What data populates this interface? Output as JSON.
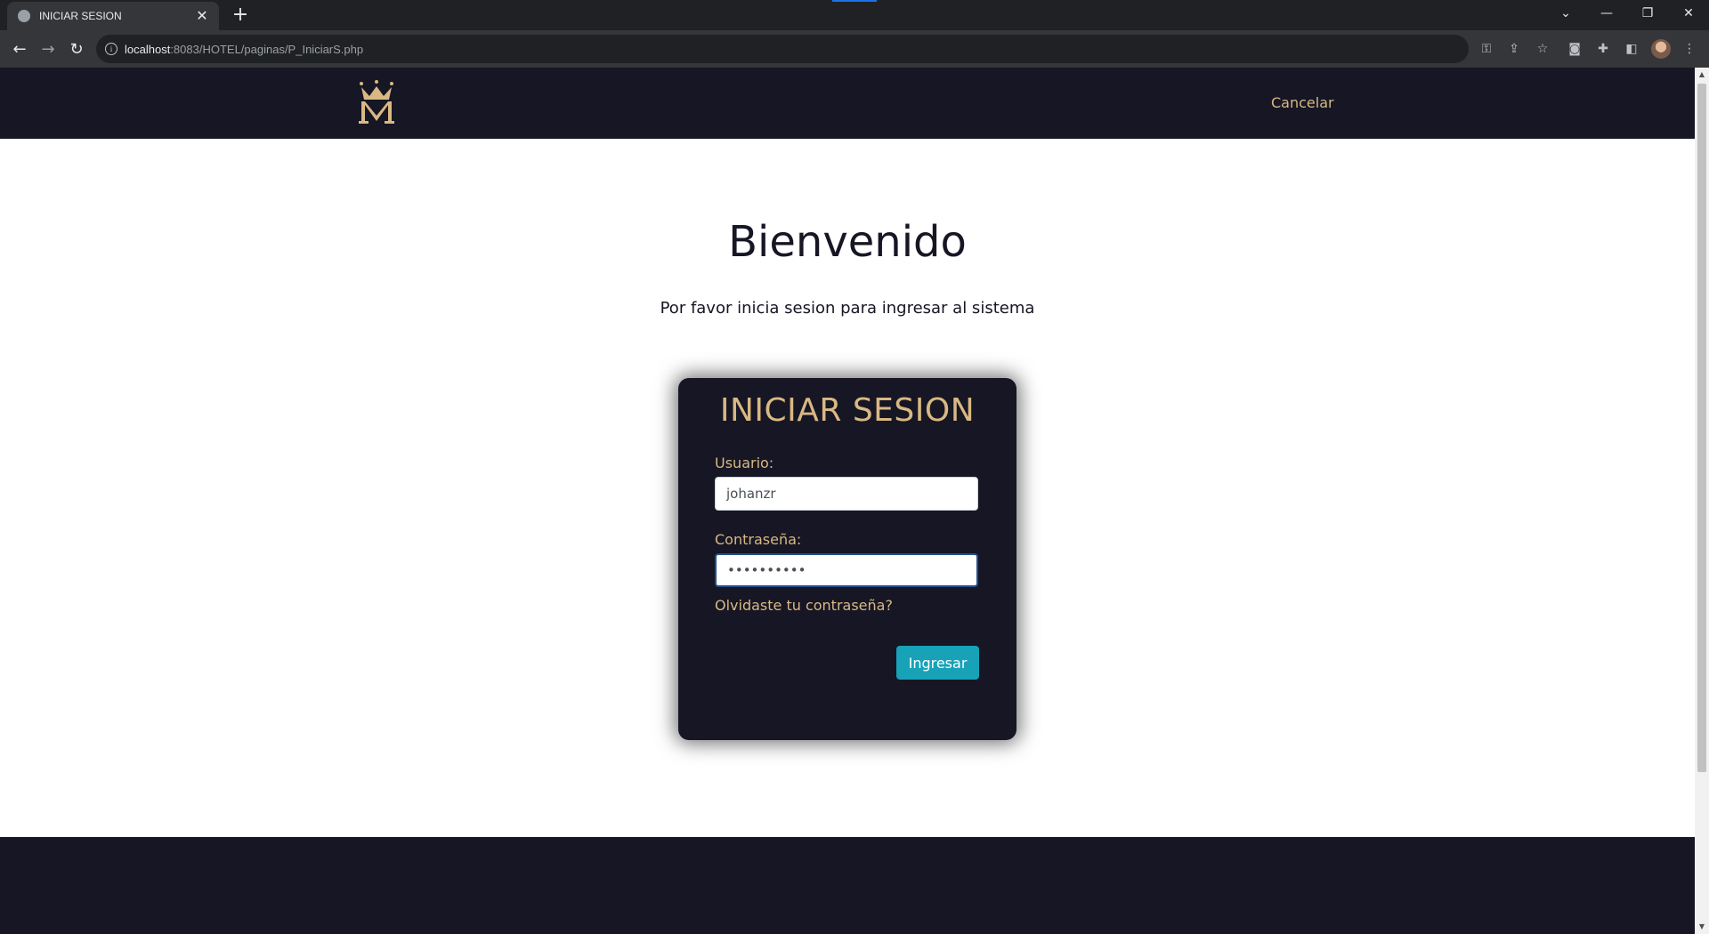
{
  "browser": {
    "tab_title": "INICIAR SESION",
    "tab_close": "✕",
    "new_tab": "+",
    "url_host": "localhost",
    "url_rest": ":8083/HOTEL/paginas/P_IniciarS.php",
    "icons": [
      "back-icon",
      "forward-icon",
      "reload-icon",
      "info-icon",
      "key-icon",
      "share-icon",
      "star-icon",
      "camera-icon",
      "extensions-icon",
      "side-panel-icon",
      "menu-icon"
    ]
  },
  "header": {
    "cancel_label": "Cancelar"
  },
  "main": {
    "welcome_title": "Bienvenido",
    "subtitle": "Por favor inicia sesion para ingresar al sistema"
  },
  "login": {
    "title": "INICIAR SESION",
    "user_label": "Usuario:",
    "user_value": "johanzr",
    "password_label": "Contraseña:",
    "password_value": "••••••••••",
    "forgot_label": "Olvidaste tu contraseña?",
    "submit_label": "Ingresar"
  },
  "colors": {
    "header_bg": "#161624",
    "accent_gold": "#d9b883",
    "button_teal": "#17a2b8",
    "text_dark": "#161624"
  }
}
